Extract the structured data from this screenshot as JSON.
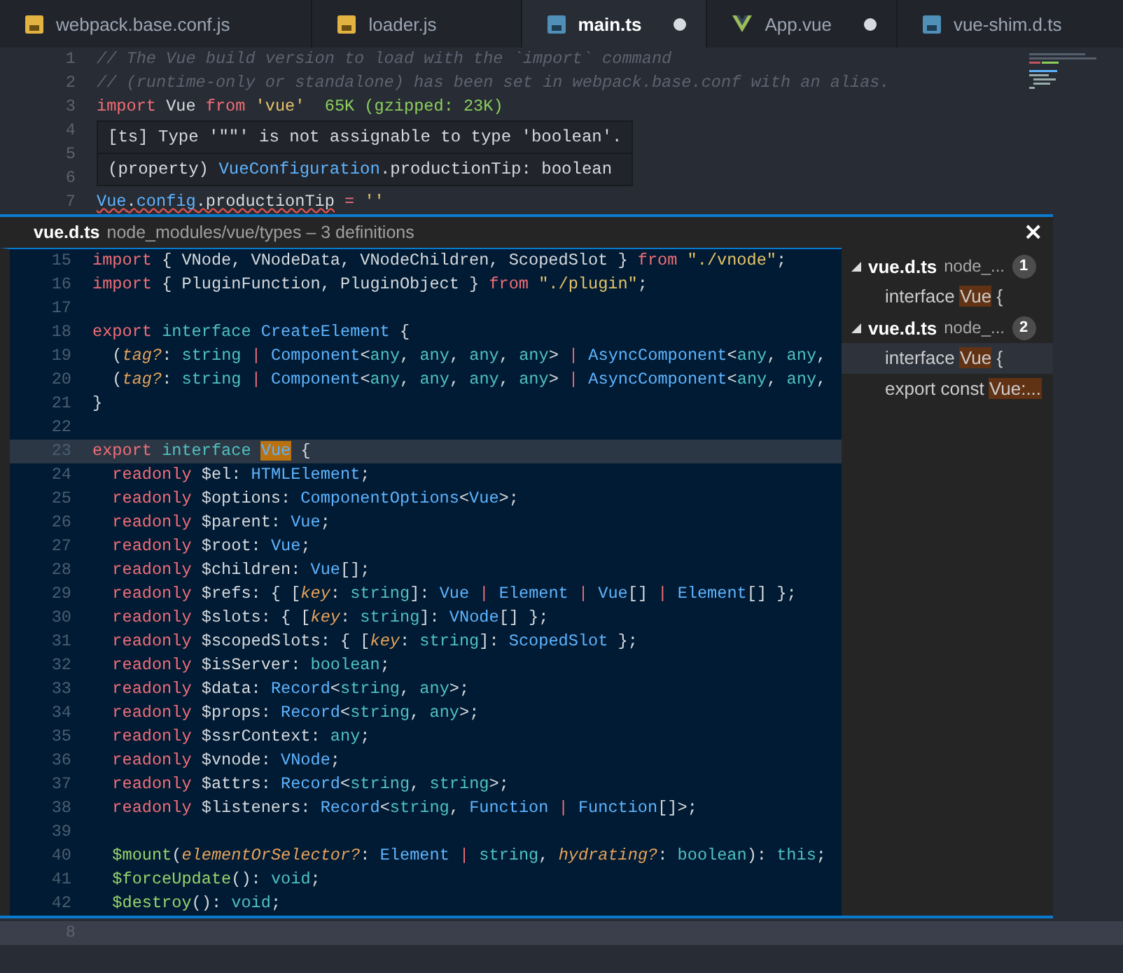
{
  "tabs": [
    {
      "label": "webpack.base.conf.js",
      "kind": "js",
      "selected": false,
      "dirty": false
    },
    {
      "label": "loader.js",
      "kind": "js",
      "selected": false,
      "dirty": false
    },
    {
      "label": "main.ts",
      "kind": "ts",
      "selected": true,
      "dirty": true
    },
    {
      "label": "App.vue",
      "kind": "vue",
      "selected": false,
      "dirty": true
    },
    {
      "label": "vue-shim.d.ts",
      "kind": "ts",
      "selected": false,
      "dirty": false
    }
  ],
  "editor": {
    "lines": [
      {
        "number": "1",
        "tokens": [
          {
            "kind": "cm",
            "text": "// The Vue build version to load with the `import` command"
          }
        ]
      },
      {
        "number": "2",
        "tokens": [
          {
            "kind": "cm",
            "text": "// (runtime-only or standalone) has been set in webpack.base.conf with an alias."
          }
        ]
      },
      {
        "number": "3",
        "tokens": [
          {
            "kind": "kw",
            "text": "import"
          },
          {
            "kind": "pl",
            "text": " Vue "
          },
          {
            "kind": "kw",
            "text": "from"
          },
          {
            "kind": "str",
            "text": " 'vue'"
          },
          {
            "kind": "cost",
            "text": "  65K (gzipped: 23K)"
          }
        ]
      },
      {
        "number": "4"
      },
      {
        "number": "5"
      },
      {
        "number": "6"
      },
      {
        "number": "7",
        "tokens": [
          {
            "kind": "tyerr",
            "text": "Vue"
          },
          {
            "kind": "plerr",
            "text": "."
          },
          {
            "kind": "tyerr",
            "text": "config"
          },
          {
            "kind": "plerr",
            "text": ".productionTip"
          },
          {
            "kind": "kw",
            "text": " = "
          },
          {
            "kind": "str",
            "text": "''"
          }
        ]
      }
    ],
    "hover": {
      "message": "[ts] Type '\"\"' is not assignable to type 'boolean'.",
      "signature": [
        {
          "kind": "pl",
          "text": "(property) "
        },
        {
          "kind": "ty",
          "text": "VueConfiguration"
        },
        {
          "kind": "pl",
          "text": ".productionTip: boolean"
        }
      ]
    }
  },
  "peek": {
    "file": "vue.d.ts",
    "path": "node_modules/vue/types – 3 definitions",
    "close": "×",
    "lines": [
      {
        "number": "15",
        "current": false,
        "tokens": [
          {
            "kind": "kw",
            "text": "import"
          },
          {
            "kind": "pl",
            "text": " { VNode, VNodeData, VNodeChildren, ScopedSlot } "
          },
          {
            "kind": "kw",
            "text": "from"
          },
          {
            "kind": "str",
            "text": " \"./vnode\""
          },
          {
            "kind": "pl",
            "text": ";"
          }
        ]
      },
      {
        "number": "16",
        "current": false,
        "tokens": [
          {
            "kind": "kw",
            "text": "import"
          },
          {
            "kind": "pl",
            "text": " { PluginFunction, PluginObject } "
          },
          {
            "kind": "kw",
            "text": "from"
          },
          {
            "kind": "str",
            "text": " \"./plugin\""
          },
          {
            "kind": "pl",
            "text": ";"
          }
        ]
      },
      {
        "number": "17",
        "current": false
      },
      {
        "number": "18",
        "current": false,
        "tokens": [
          {
            "kind": "kw",
            "text": "export"
          },
          {
            "kind": "bi",
            "text": " interface "
          },
          {
            "kind": "ty",
            "text": "CreateElement"
          },
          {
            "kind": "pl",
            "text": " {"
          }
        ]
      },
      {
        "number": "19",
        "current": false,
        "tokens": [
          {
            "kind": "pl",
            "text": "  ("
          },
          {
            "kind": "it",
            "text": "tag?"
          },
          {
            "kind": "pl",
            "text": ": "
          },
          {
            "kind": "bi",
            "text": "string"
          },
          {
            "kind": "kw",
            "text": " | "
          },
          {
            "kind": "ty",
            "text": "Component"
          },
          {
            "kind": "pl",
            "text": "<"
          },
          {
            "kind": "bi",
            "text": "any"
          },
          {
            "kind": "pl",
            "text": ", "
          },
          {
            "kind": "bi",
            "text": "any"
          },
          {
            "kind": "pl",
            "text": ", "
          },
          {
            "kind": "bi",
            "text": "any"
          },
          {
            "kind": "pl",
            "text": ", "
          },
          {
            "kind": "bi",
            "text": "any"
          },
          {
            "kind": "pl",
            "text": "> "
          },
          {
            "kind": "kw",
            "text": "| "
          },
          {
            "kind": "ty",
            "text": "AsyncComponent"
          },
          {
            "kind": "pl",
            "text": "<"
          },
          {
            "kind": "bi",
            "text": "any"
          },
          {
            "kind": "pl",
            "text": ", "
          },
          {
            "kind": "bi",
            "text": "any"
          },
          {
            "kind": "pl",
            "text": ","
          }
        ]
      },
      {
        "number": "20",
        "current": false,
        "tokens": [
          {
            "kind": "pl",
            "text": "  ("
          },
          {
            "kind": "it",
            "text": "tag?"
          },
          {
            "kind": "pl",
            "text": ": "
          },
          {
            "kind": "bi",
            "text": "string"
          },
          {
            "kind": "kw",
            "text": " | "
          },
          {
            "kind": "ty",
            "text": "Component"
          },
          {
            "kind": "pl",
            "text": "<"
          },
          {
            "kind": "bi",
            "text": "any"
          },
          {
            "kind": "pl",
            "text": ", "
          },
          {
            "kind": "bi",
            "text": "any"
          },
          {
            "kind": "pl",
            "text": ", "
          },
          {
            "kind": "bi",
            "text": "any"
          },
          {
            "kind": "pl",
            "text": ", "
          },
          {
            "kind": "bi",
            "text": "any"
          },
          {
            "kind": "pl",
            "text": "> "
          },
          {
            "kind": "kw",
            "text": "| "
          },
          {
            "kind": "ty",
            "text": "AsyncComponent"
          },
          {
            "kind": "pl",
            "text": "<"
          },
          {
            "kind": "bi",
            "text": "any"
          },
          {
            "kind": "pl",
            "text": ", "
          },
          {
            "kind": "bi",
            "text": "any"
          },
          {
            "kind": "pl",
            "text": ","
          }
        ]
      },
      {
        "number": "21",
        "current": false,
        "tokens": [
          {
            "kind": "pl",
            "text": "}"
          }
        ]
      },
      {
        "number": "22",
        "current": false
      },
      {
        "number": "23",
        "current": true,
        "tokens": [
          {
            "kind": "kw",
            "text": "export"
          },
          {
            "kind": "bi",
            "text": " interface "
          },
          {
            "kind": "tymatch",
            "text": "Vue"
          },
          {
            "kind": "pl",
            "text": " {"
          }
        ]
      },
      {
        "number": "24",
        "current": false,
        "tokens": [
          {
            "kind": "kw",
            "text": "  readonly"
          },
          {
            "kind": "pl",
            "text": " $el: "
          },
          {
            "kind": "ty",
            "text": "HTMLElement"
          },
          {
            "kind": "pl",
            "text": ";"
          }
        ]
      },
      {
        "number": "25",
        "current": false,
        "tokens": [
          {
            "kind": "kw",
            "text": "  readonly"
          },
          {
            "kind": "pl",
            "text": " $options: "
          },
          {
            "kind": "ty",
            "text": "ComponentOptions"
          },
          {
            "kind": "pl",
            "text": "<"
          },
          {
            "kind": "ty",
            "text": "Vue"
          },
          {
            "kind": "pl",
            "text": ">;"
          }
        ]
      },
      {
        "number": "26",
        "current": false,
        "tokens": [
          {
            "kind": "kw",
            "text": "  readonly"
          },
          {
            "kind": "pl",
            "text": " $parent: "
          },
          {
            "kind": "ty",
            "text": "Vue"
          },
          {
            "kind": "pl",
            "text": ";"
          }
        ]
      },
      {
        "number": "27",
        "current": false,
        "tokens": [
          {
            "kind": "kw",
            "text": "  readonly"
          },
          {
            "kind": "pl",
            "text": " $root: "
          },
          {
            "kind": "ty",
            "text": "Vue"
          },
          {
            "kind": "pl",
            "text": ";"
          }
        ]
      },
      {
        "number": "28",
        "current": false,
        "tokens": [
          {
            "kind": "kw",
            "text": "  readonly"
          },
          {
            "kind": "pl",
            "text": " $children: "
          },
          {
            "kind": "ty",
            "text": "Vue"
          },
          {
            "kind": "pl",
            "text": "[];"
          }
        ]
      },
      {
        "number": "29",
        "current": false,
        "tokens": [
          {
            "kind": "kw",
            "text": "  readonly"
          },
          {
            "kind": "pl",
            "text": " $refs: { ["
          },
          {
            "kind": "it",
            "text": "key"
          },
          {
            "kind": "pl",
            "text": ": "
          },
          {
            "kind": "bi",
            "text": "string"
          },
          {
            "kind": "pl",
            "text": "]: "
          },
          {
            "kind": "ty",
            "text": "Vue"
          },
          {
            "kind": "kw",
            "text": " | "
          },
          {
            "kind": "ty",
            "text": "Element"
          },
          {
            "kind": "kw",
            "text": " | "
          },
          {
            "kind": "ty",
            "text": "Vue"
          },
          {
            "kind": "pl",
            "text": "[] "
          },
          {
            "kind": "kw",
            "text": "| "
          },
          {
            "kind": "ty",
            "text": "Element"
          },
          {
            "kind": "pl",
            "text": "[] };"
          }
        ]
      },
      {
        "number": "30",
        "current": false,
        "tokens": [
          {
            "kind": "kw",
            "text": "  readonly"
          },
          {
            "kind": "pl",
            "text": " $slots: { ["
          },
          {
            "kind": "it",
            "text": "key"
          },
          {
            "kind": "pl",
            "text": ": "
          },
          {
            "kind": "bi",
            "text": "string"
          },
          {
            "kind": "pl",
            "text": "]: "
          },
          {
            "kind": "ty",
            "text": "VNode"
          },
          {
            "kind": "pl",
            "text": "[] };"
          }
        ]
      },
      {
        "number": "31",
        "current": false,
        "tokens": [
          {
            "kind": "kw",
            "text": "  readonly"
          },
          {
            "kind": "pl",
            "text": " $scopedSlots: { ["
          },
          {
            "kind": "it",
            "text": "key"
          },
          {
            "kind": "pl",
            "text": ": "
          },
          {
            "kind": "bi",
            "text": "string"
          },
          {
            "kind": "pl",
            "text": "]: "
          },
          {
            "kind": "ty",
            "text": "ScopedSlot"
          },
          {
            "kind": "pl",
            "text": " };"
          }
        ]
      },
      {
        "number": "32",
        "current": false,
        "tokens": [
          {
            "kind": "kw",
            "text": "  readonly"
          },
          {
            "kind": "pl",
            "text": " $isServer: "
          },
          {
            "kind": "bi",
            "text": "boolean"
          },
          {
            "kind": "pl",
            "text": ";"
          }
        ]
      },
      {
        "number": "33",
        "current": false,
        "tokens": [
          {
            "kind": "kw",
            "text": "  readonly"
          },
          {
            "kind": "pl",
            "text": " $data: "
          },
          {
            "kind": "ty",
            "text": "Record"
          },
          {
            "kind": "pl",
            "text": "<"
          },
          {
            "kind": "bi",
            "text": "string"
          },
          {
            "kind": "pl",
            "text": ", "
          },
          {
            "kind": "bi",
            "text": "any"
          },
          {
            "kind": "pl",
            "text": ">;"
          }
        ]
      },
      {
        "number": "34",
        "current": false,
        "tokens": [
          {
            "kind": "kw",
            "text": "  readonly"
          },
          {
            "kind": "pl",
            "text": " $props: "
          },
          {
            "kind": "ty",
            "text": "Record"
          },
          {
            "kind": "pl",
            "text": "<"
          },
          {
            "kind": "bi",
            "text": "string"
          },
          {
            "kind": "pl",
            "text": ", "
          },
          {
            "kind": "bi",
            "text": "any"
          },
          {
            "kind": "pl",
            "text": ">;"
          }
        ]
      },
      {
        "number": "35",
        "current": false,
        "tokens": [
          {
            "kind": "kw",
            "text": "  readonly"
          },
          {
            "kind": "pl",
            "text": " $ssrContext: "
          },
          {
            "kind": "bi",
            "text": "any"
          },
          {
            "kind": "pl",
            "text": ";"
          }
        ]
      },
      {
        "number": "36",
        "current": false,
        "tokens": [
          {
            "kind": "kw",
            "text": "  readonly"
          },
          {
            "kind": "pl",
            "text": " $vnode: "
          },
          {
            "kind": "ty",
            "text": "VNode"
          },
          {
            "kind": "pl",
            "text": ";"
          }
        ]
      },
      {
        "number": "37",
        "current": false,
        "tokens": [
          {
            "kind": "kw",
            "text": "  readonly"
          },
          {
            "kind": "pl",
            "text": " $attrs: "
          },
          {
            "kind": "ty",
            "text": "Record"
          },
          {
            "kind": "pl",
            "text": "<"
          },
          {
            "kind": "bi",
            "text": "string"
          },
          {
            "kind": "pl",
            "text": ", "
          },
          {
            "kind": "bi",
            "text": "string"
          },
          {
            "kind": "pl",
            "text": ">;"
          }
        ]
      },
      {
        "number": "38",
        "current": false,
        "tokens": [
          {
            "kind": "kw",
            "text": "  readonly"
          },
          {
            "kind": "pl",
            "text": " $listeners: "
          },
          {
            "kind": "ty",
            "text": "Record"
          },
          {
            "kind": "pl",
            "text": "<"
          },
          {
            "kind": "bi",
            "text": "string"
          },
          {
            "kind": "pl",
            "text": ", "
          },
          {
            "kind": "ty",
            "text": "Function"
          },
          {
            "kind": "kw",
            "text": " | "
          },
          {
            "kind": "ty",
            "text": "Function"
          },
          {
            "kind": "pl",
            "text": "[]>;"
          }
        ]
      },
      {
        "number": "39",
        "current": false
      },
      {
        "number": "40",
        "current": false,
        "tokens": [
          {
            "kind": "fn",
            "text": "  $mount"
          },
          {
            "kind": "pl",
            "text": "("
          },
          {
            "kind": "it",
            "text": "elementOrSelector?"
          },
          {
            "kind": "pl",
            "text": ": "
          },
          {
            "kind": "ty",
            "text": "Element"
          },
          {
            "kind": "kw",
            "text": " | "
          },
          {
            "kind": "bi",
            "text": "string"
          },
          {
            "kind": "pl",
            "text": ", "
          },
          {
            "kind": "it",
            "text": "hydrating?"
          },
          {
            "kind": "pl",
            "text": ": "
          },
          {
            "kind": "bi",
            "text": "boolean"
          },
          {
            "kind": "pl",
            "text": "): "
          },
          {
            "kind": "bi",
            "text": "this"
          },
          {
            "kind": "pl",
            "text": ";"
          }
        ]
      },
      {
        "number": "41",
        "current": false,
        "tokens": [
          {
            "kind": "fn",
            "text": "  $forceUpdate"
          },
          {
            "kind": "pl",
            "text": "(): "
          },
          {
            "kind": "bi",
            "text": "void"
          },
          {
            "kind": "pl",
            "text": ";"
          }
        ]
      },
      {
        "number": "42",
        "current": false,
        "tokens": [
          {
            "kind": "fn",
            "text": "  $destroy"
          },
          {
            "kind": "pl",
            "text": "(): "
          },
          {
            "kind": "bi",
            "text": "void"
          },
          {
            "kind": "pl",
            "text": ";"
          }
        ]
      }
    ],
    "references": [
      {
        "file": "vue.d.ts",
        "path": "node_...",
        "count": "1",
        "expanded": true,
        "children": [
          {
            "before": "interface ",
            "match": "Vue",
            "after": " {",
            "selected": false
          }
        ]
      },
      {
        "file": "vue.d.ts",
        "path": "node_...",
        "count": "2",
        "expanded": true,
        "children": [
          {
            "before": "interface ",
            "match": "Vue",
            "after": " {",
            "selected": true
          },
          {
            "before": "export const ",
            "match": "Vue:...",
            "selected": false
          }
        ]
      }
    ]
  },
  "editor_below": {
    "lines": [
      {
        "number": "8",
        "current": true
      }
    ]
  }
}
